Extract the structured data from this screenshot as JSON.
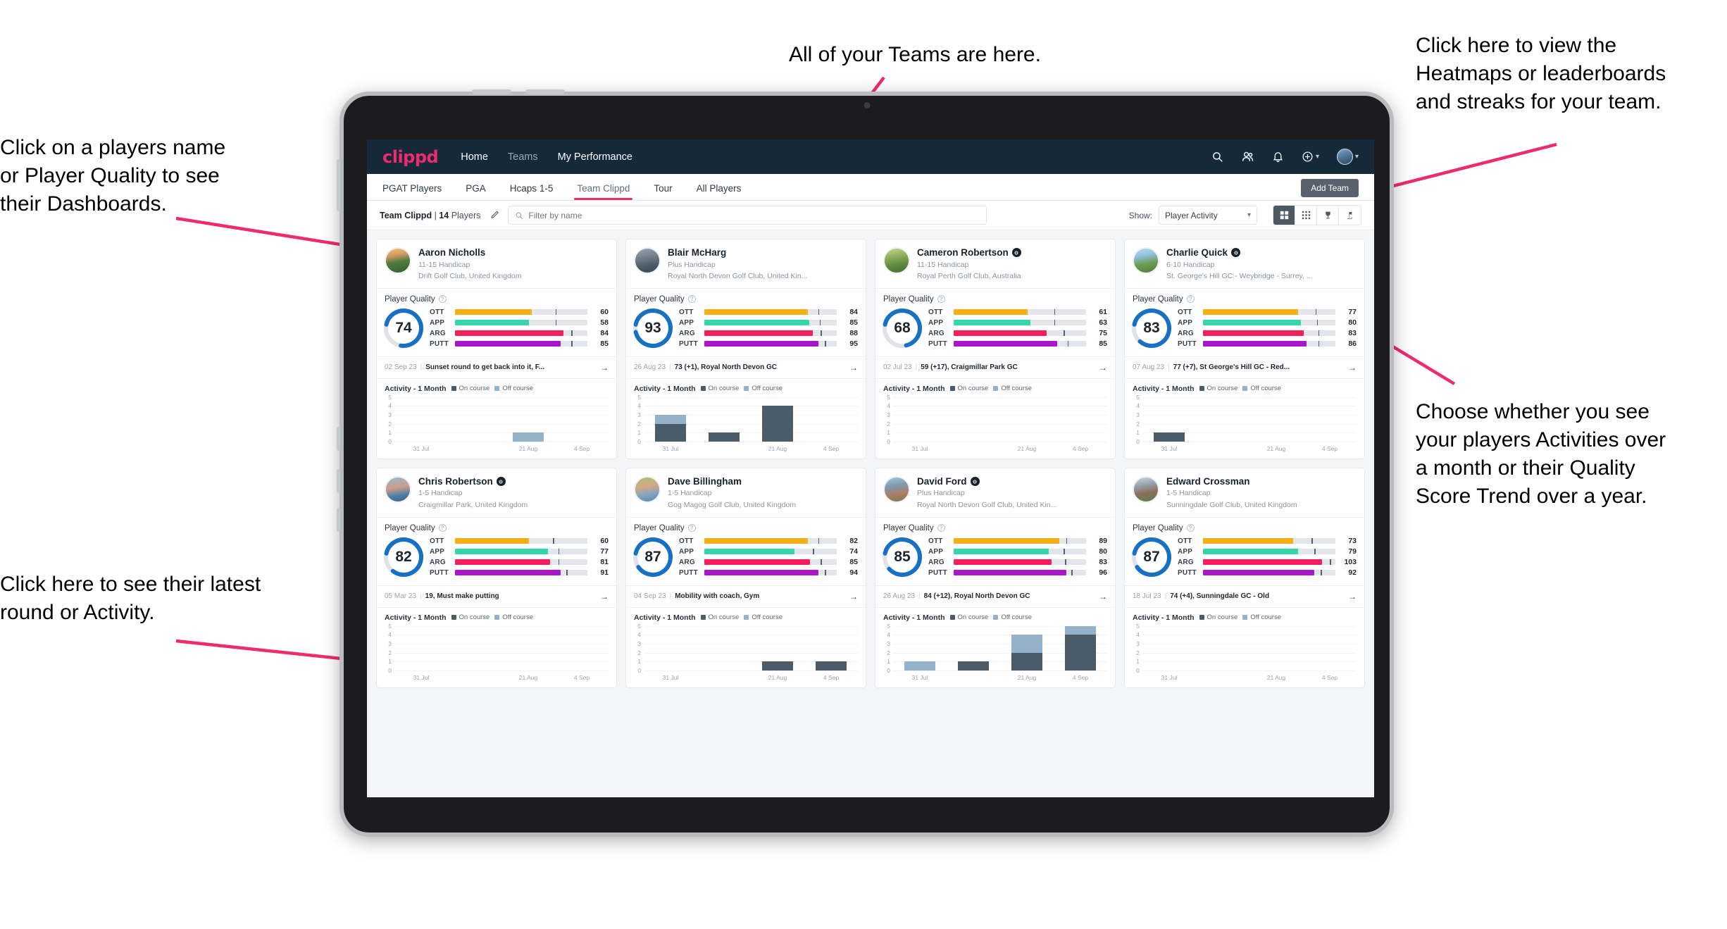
{
  "annotations": {
    "left_top": "Click on a players name\nor Player Quality to see\ntheir Dashboards.",
    "center_top": "All of your Teams are here.",
    "right_top": "Click here to view the\nHeatmaps or leaderboards\nand streaks for your team.",
    "right_mid": "Choose whether you see\nyour players Activities over\na month or their Quality\nScore Trend over a year.",
    "left_bottom": "Click here to see their latest\nround or Activity."
  },
  "topnav": {
    "logo": "clippd",
    "links": [
      {
        "label": "Home",
        "active": true
      },
      {
        "label": "Teams",
        "active": false
      },
      {
        "label": "My Performance",
        "active": true
      }
    ],
    "icons": [
      "search-icon",
      "people-icon",
      "bell-icon",
      "plus-circle-icon",
      "avatar"
    ]
  },
  "subnav": {
    "tabs": [
      {
        "label": "PGAT Players",
        "active": false
      },
      {
        "label": "PGA",
        "active": false
      },
      {
        "label": "Hcaps 1-5",
        "active": false
      },
      {
        "label": "Team Clippd",
        "active": true
      },
      {
        "label": "Tour",
        "active": false
      },
      {
        "label": "All Players",
        "active": false
      }
    ],
    "add_team_label": "Add Team"
  },
  "toolbar": {
    "team_name": "Team Clippd",
    "team_count": "14",
    "players_word": "Players",
    "edit_icon": "pencil-icon",
    "search_placeholder": "Filter by name",
    "search_value": "",
    "show_label": "Show:",
    "show_value": "Player Activity",
    "show_options": [
      "Player Activity",
      "Quality Score Trend"
    ],
    "view_buttons": [
      "grid-large-icon",
      "grid-small-icon",
      "trophy-icon",
      "flag-icon"
    ],
    "view_active_index": 0
  },
  "card_labels": {
    "player_quality": "Player Quality",
    "help_icon": "question-mark-icon",
    "activity_title": "Activity - 1 Month",
    "legend_on": "On course",
    "legend_off": "Off course",
    "arrow_icon": "arrow-right-icon",
    "verified_icon": "verified-badge-icon"
  },
  "colors": {
    "brand_pink": "#ef2b70",
    "nav_dark": "#16293b",
    "ott": "#f6b015",
    "app": "#36d6ac",
    "arg": "#f51f5c",
    "putt": "#a916c9",
    "ring": "#1670c4",
    "ring_track": "#dfe3e7",
    "on_course": "#4c5b68",
    "off_course": "#93b1c9"
  },
  "chart_data": {
    "type": "bar",
    "title": "Activity - 1 Month",
    "ylabel": "",
    "xlabel": "",
    "ylim": [
      0,
      5
    ],
    "yticks": [
      0,
      1,
      2,
      3,
      4,
      5
    ],
    "categories": [
      "31 Jul",
      "",
      "21 Aug",
      "4 Sep"
    ],
    "legend": [
      "On course",
      "Off course"
    ],
    "legend_position": "top",
    "grid": true,
    "charts": [
      {
        "player": "Aaron Nicholls",
        "on_course": [
          0,
          0,
          0,
          0
        ],
        "off_course": [
          0,
          0,
          1,
          0
        ]
      },
      {
        "player": "Blair McHarg",
        "on_course": [
          2,
          1,
          4,
          0
        ],
        "off_course": [
          1,
          0,
          0,
          0
        ]
      },
      {
        "player": "Cameron Robertson",
        "on_course": [
          0,
          0,
          0,
          0
        ],
        "off_course": [
          0,
          0,
          0,
          0
        ]
      },
      {
        "player": "Charlie Quick",
        "on_course": [
          1,
          0,
          0,
          0
        ],
        "off_course": [
          0,
          0,
          0,
          0
        ]
      },
      {
        "player": "Chris Robertson",
        "on_course": [
          0,
          0,
          0,
          0
        ],
        "off_course": [
          0,
          0,
          0,
          0
        ]
      },
      {
        "player": "Dave Billingham",
        "on_course": [
          0,
          0,
          1,
          1
        ],
        "off_course": [
          0,
          0,
          0,
          0
        ]
      },
      {
        "player": "David Ford",
        "on_course": [
          0,
          1,
          2,
          4
        ],
        "off_course": [
          1,
          0,
          2,
          1
        ]
      },
      {
        "player": "Edward Crossman",
        "on_course": [
          0,
          0,
          0,
          0
        ],
        "off_course": [
          0,
          0,
          0,
          0
        ]
      }
    ]
  },
  "players": [
    {
      "name": "Aaron Nicholls",
      "verified": false,
      "handicap": "11-15 Handicap",
      "club": "Drift Golf Club, United Kingdom",
      "quality": 74,
      "metrics": [
        {
          "label": "OTT",
          "value": 60,
          "fill": 58,
          "tick": 76,
          "color": "#f6b015"
        },
        {
          "label": "APP",
          "value": 58,
          "fill": 56,
          "tick": 76,
          "color": "#36d6ac"
        },
        {
          "label": "ARG",
          "value": 84,
          "fill": 82,
          "tick": 88,
          "color": "#f51f5c"
        },
        {
          "label": "PUTT",
          "value": 85,
          "fill": 80,
          "tick": 88,
          "color": "#a916c9"
        }
      ],
      "round_date": "02 Sep 23",
      "round_text": "Sunset round to get back into it, F...",
      "avatar_css": "linear-gradient(170deg,#f2c27a 0%,#d89a60 28%,#4f7d3e 55%,#2f6130 100%)"
    },
    {
      "name": "Blair McHarg",
      "verified": false,
      "handicap": "Plus Handicap",
      "club": "Royal North Devon Golf Club, United Kin...",
      "quality": 93,
      "metrics": [
        {
          "label": "OTT",
          "value": 84,
          "fill": 78,
          "tick": 86,
          "color": "#f6b015"
        },
        {
          "label": "APP",
          "value": 85,
          "fill": 79,
          "tick": 87,
          "color": "#36d6ac"
        },
        {
          "label": "ARG",
          "value": 88,
          "fill": 82,
          "tick": 88,
          "color": "#f51f5c"
        },
        {
          "label": "PUTT",
          "value": 95,
          "fill": 86,
          "tick": 91,
          "color": "#a916c9"
        }
      ],
      "round_date": "26 Aug 23",
      "round_text": "73 (+1), Royal North Devon GC",
      "avatar_css": "linear-gradient(170deg,#9aa8b4 0%,#6d7c88 40%,#4a5a66 70%,#3b4a55 100%)"
    },
    {
      "name": "Cameron Robertson",
      "verified": true,
      "handicap": "11-15 Handicap",
      "club": "Royal Perth Golf Club, Australia",
      "quality": 68,
      "metrics": [
        {
          "label": "OTT",
          "value": 61,
          "fill": 56,
          "tick": 76,
          "color": "#f6b015"
        },
        {
          "label": "APP",
          "value": 63,
          "fill": 58,
          "tick": 76,
          "color": "#36d6ac"
        },
        {
          "label": "ARG",
          "value": 75,
          "fill": 70,
          "tick": 83,
          "color": "#f51f5c"
        },
        {
          "label": "PUTT",
          "value": 85,
          "fill": 78,
          "tick": 86,
          "color": "#a916c9"
        }
      ],
      "round_date": "02 Jul 23",
      "round_text": "59 (+17), Craigmillar Park GC",
      "avatar_css": "linear-gradient(170deg,#cbd18a 0%,#8fae5e 35%,#5f8a3f 65%,#47702f 100%)"
    },
    {
      "name": "Charlie Quick",
      "verified": true,
      "handicap": "6-10 Handicap",
      "club": "St. George's Hill GC - Weybridge - Surrey, ...",
      "quality": 83,
      "metrics": [
        {
          "label": "OTT",
          "value": 77,
          "fill": 72,
          "tick": 85,
          "color": "#f6b015"
        },
        {
          "label": "APP",
          "value": 80,
          "fill": 74,
          "tick": 86,
          "color": "#36d6ac"
        },
        {
          "label": "ARG",
          "value": 83,
          "fill": 76,
          "tick": 87,
          "color": "#f51f5c"
        },
        {
          "label": "PUTT",
          "value": 86,
          "fill": 78,
          "tick": 87,
          "color": "#a916c9"
        }
      ],
      "round_date": "07 Aug 23",
      "round_text": "77 (+7), St George's Hill GC - Red...",
      "avatar_css": "linear-gradient(170deg,#bcd9ee 0%,#8ec2e0 30%,#6f9d55 60%,#4e7f3c 100%)"
    },
    {
      "name": "Chris Robertson",
      "verified": true,
      "handicap": "1-5 Handicap",
      "club": "Craigmillar Park, United Kingdom",
      "quality": 82,
      "metrics": [
        {
          "label": "OTT",
          "value": 60,
          "fill": 56,
          "tick": 74,
          "color": "#f6b015"
        },
        {
          "label": "APP",
          "value": 77,
          "fill": 70,
          "tick": 78,
          "color": "#36d6ac"
        },
        {
          "label": "ARG",
          "value": 81,
          "fill": 72,
          "tick": 78,
          "color": "#f51f5c"
        },
        {
          "label": "PUTT",
          "value": 91,
          "fill": 80,
          "tick": 84,
          "color": "#a916c9"
        }
      ],
      "round_date": "05 Mar 23",
      "round_text": "19, Must make putting",
      "avatar_css": "linear-gradient(170deg,#8fb8d8 0%,#cf9e84 42%,#4e7ea8 72%,#3b6288 100%)"
    },
    {
      "name": "Dave Billingham",
      "verified": false,
      "handicap": "1-5 Handicap",
      "club": "Gog Magog Golf Club, United Kingdom",
      "quality": 87,
      "metrics": [
        {
          "label": "OTT",
          "value": 82,
          "fill": 78,
          "tick": 86,
          "color": "#f6b015"
        },
        {
          "label": "APP",
          "value": 74,
          "fill": 68,
          "tick": 82,
          "color": "#36d6ac"
        },
        {
          "label": "ARG",
          "value": 85,
          "fill": 80,
          "tick": 88,
          "color": "#f51f5c"
        },
        {
          "label": "PUTT",
          "value": 94,
          "fill": 86,
          "tick": 91,
          "color": "#a916c9"
        }
      ],
      "round_date": "04 Sep 23",
      "round_text": "Mobility with coach, Gym",
      "avatar_css": "linear-gradient(170deg,#9fc27c 0%,#d8a882 38%,#7fa4c4 70%,#5a86aa 100%)"
    },
    {
      "name": "David Ford",
      "verified": true,
      "handicap": "Plus Handicap",
      "club": "Royal North Devon Golf Club, United Kin...",
      "quality": 85,
      "metrics": [
        {
          "label": "OTT",
          "value": 89,
          "fill": 80,
          "tick": 85,
          "color": "#f6b015"
        },
        {
          "label": "APP",
          "value": 80,
          "fill": 72,
          "tick": 83,
          "color": "#36d6ac"
        },
        {
          "label": "ARG",
          "value": 83,
          "fill": 74,
          "tick": 84,
          "color": "#f51f5c"
        },
        {
          "label": "PUTT",
          "value": 96,
          "fill": 85,
          "tick": 89,
          "color": "#a916c9"
        }
      ],
      "round_date": "26 Aug 23",
      "round_text": "84 (+12), Royal North Devon GC",
      "avatar_css": "linear-gradient(170deg,#a9c4d8 0%,#7e9ab0 35%,#b07c62 68%,#6c7f55 100%)"
    },
    {
      "name": "Edward Crossman",
      "verified": false,
      "handicap": "1-5 Handicap",
      "club": "Sunningdale Golf Club, United Kingdom",
      "quality": 87,
      "metrics": [
        {
          "label": "OTT",
          "value": 73,
          "fill": 68,
          "tick": 82,
          "color": "#f6b015"
        },
        {
          "label": "APP",
          "value": 79,
          "fill": 72,
          "tick": 84,
          "color": "#36d6ac"
        },
        {
          "label": "ARG",
          "value": 103,
          "fill": 90,
          "tick": 96,
          "color": "#f51f5c"
        },
        {
          "label": "PUTT",
          "value": 92,
          "fill": 84,
          "tick": 89,
          "color": "#a916c9"
        }
      ],
      "round_date": "18 Jul 23",
      "round_text": "74 (+4), Sunningdale GC - Old",
      "avatar_css": "linear-gradient(170deg,#cfd6dd 0%,#9aa6b2 30%,#8a6f5c 62%,#5f7f4a 100%)"
    }
  ]
}
